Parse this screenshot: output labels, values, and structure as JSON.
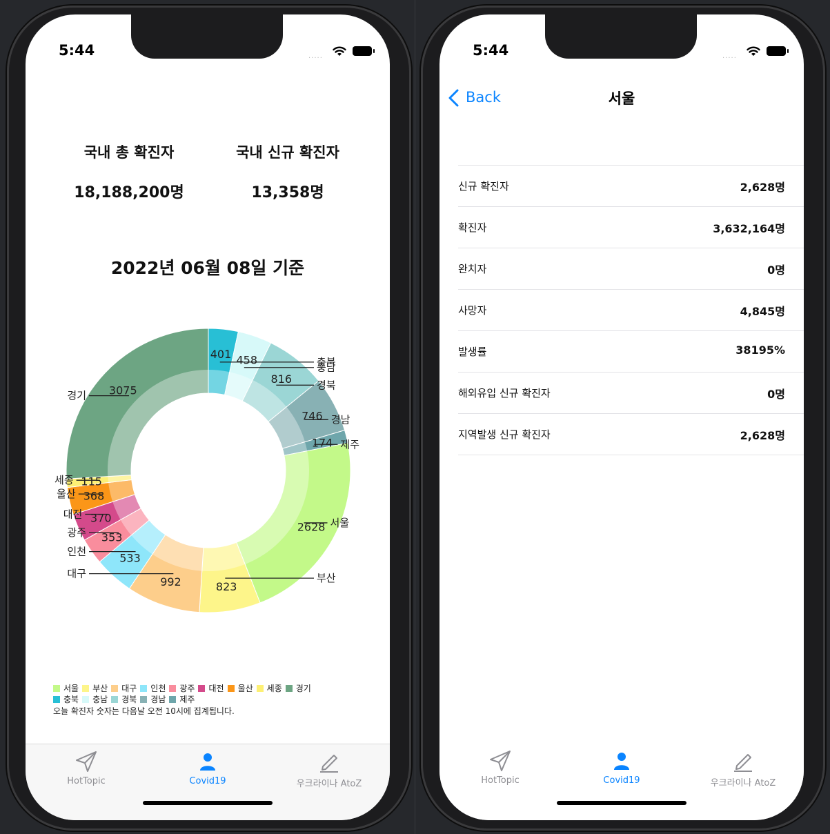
{
  "status_bar": {
    "time": "5:44",
    "dots": "....."
  },
  "summary": {
    "total_label": "국내 총 확진자",
    "total_value": "18,188,200명",
    "new_label": "국내 신규 확진자",
    "new_value": "13,358명"
  },
  "date_title": "2022년 06월 08일 기준",
  "chart_data": {
    "type": "pie",
    "donut": true,
    "categories": [
      "서울",
      "부산",
      "대구",
      "인천",
      "광주",
      "대전",
      "울산",
      "세종",
      "경기",
      "충북",
      "충남",
      "경북",
      "경남",
      "제주"
    ],
    "values": [
      2628,
      823,
      992,
      533,
      353,
      370,
      368,
      115,
      3075,
      401,
      458,
      816,
      746,
      174
    ],
    "colors": [
      "#c3f989",
      "#fdf58a",
      "#fdce8b",
      "#8ee6fa",
      "#f98d9d",
      "#d44a8b",
      "#fb9618",
      "#fdf074",
      "#6da583",
      "#28bfd5",
      "#d7f9f9",
      "#9bd6d5",
      "#88b1b4",
      "#6ea6ab"
    ],
    "legend_position": "bottom-left",
    "legend": [
      "서울",
      "부산",
      "대구",
      "인천",
      "광주",
      "대전",
      "울산",
      "세종",
      "경기",
      "충북",
      "충남",
      "경북",
      "경남",
      "제주"
    ]
  },
  "note": "오늘 확진자 숫자는 다음날 오전 10시에 집계됩니다.",
  "tabs": [
    {
      "label": "HotTopic",
      "icon": "paper-plane-icon",
      "active": false
    },
    {
      "label": "Covid19",
      "icon": "person-icon",
      "active": true
    },
    {
      "label": "우크라이나 AtoZ",
      "icon": "pencil-icon",
      "active": false
    }
  ],
  "detail": {
    "back_label": "Back",
    "title": "서울",
    "rows": [
      {
        "label": "신규 확진자",
        "value": "2,628명"
      },
      {
        "label": "확진자",
        "value": "3,632,164명"
      },
      {
        "label": "완치자",
        "value": "0명"
      },
      {
        "label": "사망자",
        "value": "4,845명"
      },
      {
        "label": "발생률",
        "value": "38195%"
      },
      {
        "label": "해외유입 신규 확진자",
        "value": "0명"
      },
      {
        "label": "지역발생 신규 확진자",
        "value": "2,628명"
      }
    ]
  },
  "colors": {
    "accent": "#0a84ff",
    "inactive": "#8e8e93"
  }
}
